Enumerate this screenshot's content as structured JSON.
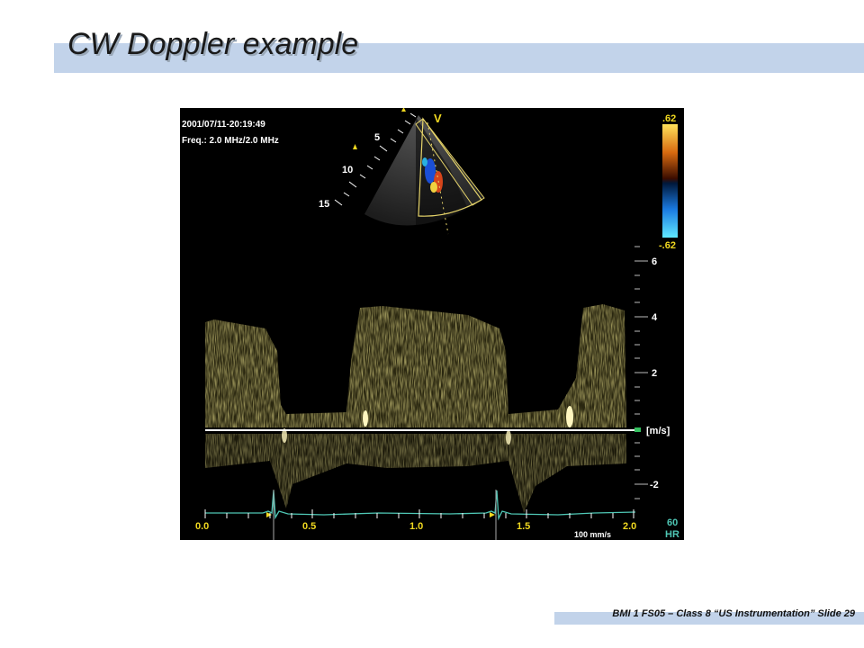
{
  "slide": {
    "title": "CW Doppler example",
    "footer": "BMI 1 FS05 – Class 8 “US Instrumentation”  Slide 29"
  },
  "ultrasound": {
    "timestamp": "2001/07/11-20:19:49",
    "freq": "Freq.: 2.0 MHz/2.0 MHz",
    "marker_v": "V",
    "depth_labels": [
      "5",
      "10",
      "15"
    ],
    "color_scale_top": ".62",
    "color_scale_bottom": "-.62",
    "velocity_labels": [
      "6",
      "4",
      "2",
      "[m/s]",
      "-2"
    ],
    "time_labels": [
      "0.0",
      "0.5",
      "1.0",
      "1.5",
      "2.0"
    ],
    "sweep_speed": "100 mm/s",
    "hr_value": "60",
    "hr_label": "HR"
  },
  "colors": {
    "doppler": "#e8d65a",
    "ecg": "#4fc7b5",
    "accent": "#c2d3ea"
  }
}
